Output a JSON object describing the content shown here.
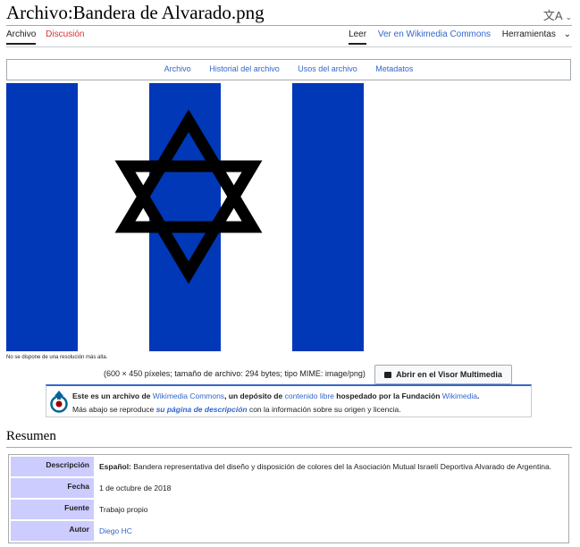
{
  "page": {
    "title": "Archivo:Bandera de Alvarado.png",
    "lang_icon": "translate-icon",
    "lang_chevron": "chevron-down-icon"
  },
  "tabs_left": [
    "Archivo",
    "Discusión"
  ],
  "tabs_right": [
    "Leer",
    "Ver en Wikimedia Commons",
    "Herramientas"
  ],
  "file_toc": [
    "Archivo",
    "Historial del archivo",
    "Usos del archivo",
    "Metadatos"
  ],
  "image": {
    "flag_colors": {
      "blue": "#0038b8",
      "white": "#ffffff",
      "star": "#000000"
    },
    "no_higher_res": "No se dispone de una resolución más alta.",
    "file_info": "(600 × 450 píxeles; tamaño de archivo: 294 bytes; tipo MIME: image/png)",
    "mmv_button": "Abrir en el Visor Multimedia",
    "mmv_icon": "image-icon"
  },
  "commons": {
    "line1_a": "Este es un archivo de ",
    "line1_link1": "Wikimedia Commons",
    "line1_b": ", un depósito de ",
    "line1_link2": "contenido libre",
    "line1_c": " hospedado por la Fundación ",
    "line1_link3": "Wikimedia",
    "line1_d": ".",
    "line2_a": "Más abajo se reproduce ",
    "line2_link": "su página de descripción",
    "line2_b": " con la información sobre su origen y licencia.",
    "logo": "commons-logo-icon"
  },
  "summary": {
    "heading": "Resumen",
    "rows": [
      {
        "label": "Descripción",
        "lang": "Español:",
        "value": " Bandera representativa del diseño y disposición de colores del la Asociación Mutual Israelí Deportiva Alvarado de Argentina."
      },
      {
        "label": "Fecha",
        "value": "1 de octubre de 2018"
      },
      {
        "label": "Fuente",
        "value": "Trabajo propio"
      },
      {
        "label": "Autor",
        "value": "Diego HC"
      }
    ]
  }
}
